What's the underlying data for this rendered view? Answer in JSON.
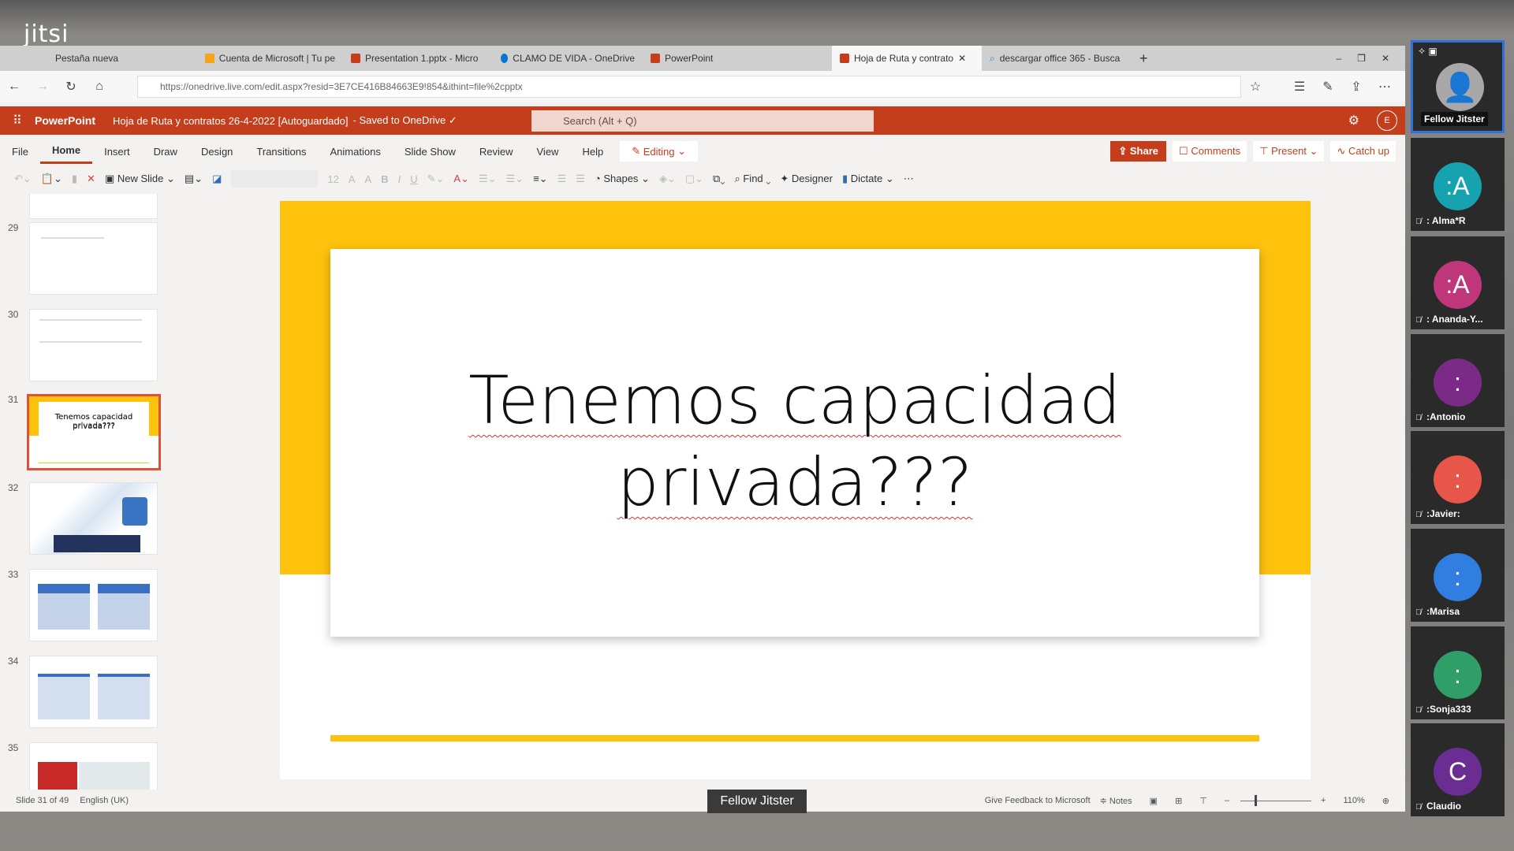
{
  "jitsi": {
    "logo": "jitsi"
  },
  "browser": {
    "tabs": [
      {
        "label": "Pestaña nueva"
      },
      {
        "label": "Cuenta de Microsoft | Tu pe"
      },
      {
        "label": "Presentation 1.pptx - Micro"
      },
      {
        "label": "CLAMO DE VIDA - OneDrive"
      },
      {
        "label": "PowerPoint"
      },
      {
        "label": "Hoja de Ruta y contrato",
        "active": true
      },
      {
        "label": "descargar office 365 - Busca"
      }
    ],
    "url": "https://onedrive.live.com/edit.aspx?resid=3E7CE416B84663E9!854&ithint=file%2cpptx"
  },
  "ppt": {
    "app": "PowerPoint",
    "doc_title": "Hoja de Ruta y contratos 26-4-2022 [Autoguardado]",
    "saved": "- Saved to OneDrive ✓",
    "search_placeholder": "Search (Alt + Q)",
    "user_initial": "E",
    "tabs": [
      "File",
      "Home",
      "Insert",
      "Draw",
      "Design",
      "Transitions",
      "Animations",
      "Slide Show",
      "Review",
      "View",
      "Help"
    ],
    "editing": "Editing",
    "share": "Share",
    "comments": "Comments",
    "present": "Present",
    "catch_up": "Catch up",
    "toolbar": {
      "new_slide": "New Slide",
      "font_size": "12",
      "shapes": "Shapes",
      "find": "Find",
      "designer": "Designer",
      "dictate": "Dictate"
    },
    "slides": [
      {
        "n": "29"
      },
      {
        "n": "30"
      },
      {
        "n": "31",
        "title": "Tenemos capacidad privada???"
      },
      {
        "n": "32"
      },
      {
        "n": "33"
      },
      {
        "n": "34"
      },
      {
        "n": "35"
      }
    ],
    "current_slide": {
      "line1": "Tenemos capacidad",
      "line2": "privada???"
    },
    "status": {
      "slide": "Slide 31 of 49",
      "lang": "English (UK)",
      "feedback": "Give Feedback to Microsoft",
      "notes": "Notes",
      "zoom": "110%"
    }
  },
  "meeting": {
    "speaker_tag": "Fellow Jitster",
    "participants": [
      {
        "name": "Fellow Jitster",
        "initial": "",
        "color": "#a8a8a8"
      },
      {
        "name": ": Alma*R",
        "initial": ":A",
        "color": "#17a2b0"
      },
      {
        "name": ": Ananda-Y...",
        "initial": ":A",
        "color": "#c0367a"
      },
      {
        "name": ":Antonio",
        "initial": ":",
        "color": "#7b2a88"
      },
      {
        "name": ":Javier:",
        "initial": ":",
        "color": "#e8564a"
      },
      {
        "name": ":Marisa",
        "initial": ":",
        "color": "#2f7ee0"
      },
      {
        "name": ":Sonja333",
        "initial": ":",
        "color": "#2f9e68"
      },
      {
        "name": "Claudio",
        "initial": "C",
        "color": "#6a2e93"
      }
    ]
  },
  "colors": {
    "ppt_red": "#c43e1c",
    "slide_yellow": "#fec20d"
  }
}
